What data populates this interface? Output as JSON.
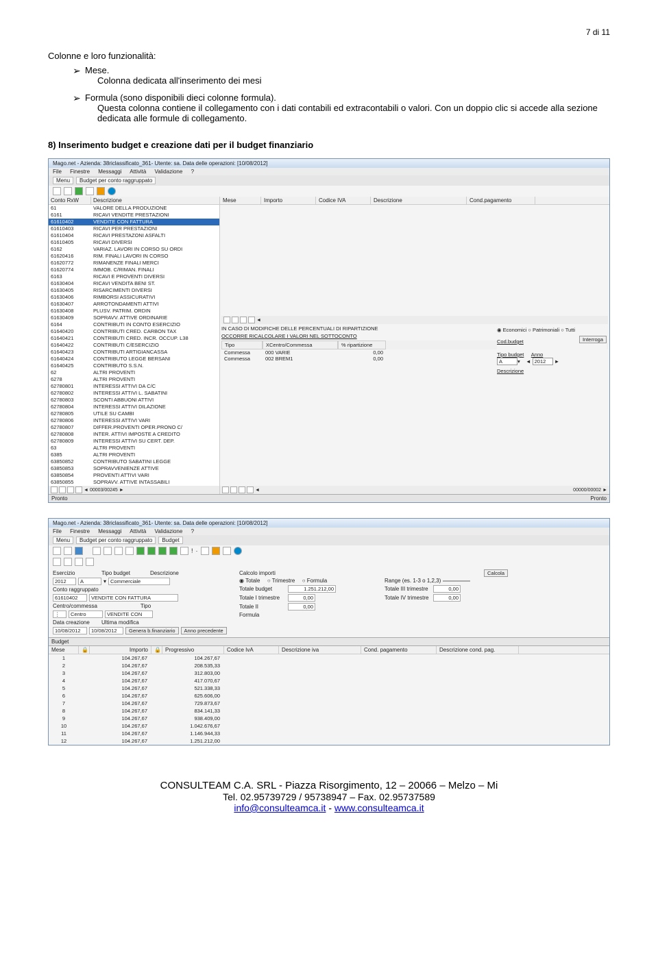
{
  "page_num": "7 di 11",
  "intro_title": "Colonne e loro funzionalità:",
  "bullets": [
    {
      "head": "Mese.",
      "sub": "Colonna dedicata all'inserimento dei mesi"
    },
    {
      "head": "Formula (sono disponibili dieci colonne formula).",
      "sub": "Questa colonna contiene il collegamento con i dati contabili ed extracontabili o valori. Con un doppio clic si accede alla sezione dedicata alle formule di collegamento."
    }
  ],
  "heading8": "8) Inserimento budget e creazione dati per il budget finanziario",
  "ss1": {
    "title": "Mago.net - Azienda: 38riclassificato_361- Utente: sa. Data delle operazioni: [10/08/2012]",
    "menu": [
      "File",
      "Finestre",
      "Messaggi",
      "Attività",
      "Validazione",
      "?"
    ],
    "tab_menu": "Menu",
    "tab_label": "Budget per conto raggruppato",
    "list_header": {
      "code": "Conto RxW",
      "desc": "Descrizione"
    },
    "top_grid": {
      "mese": "Mese",
      "importo": "Importo",
      "iva": "Codice IVA",
      "desc": "Descrizione",
      "cond": "Cond.pagamento"
    },
    "mid_note1": "IN CASO DI MODIFICHE DELLE PERCENTUALI DI RIPARTIZIONE",
    "mid_note2": "OCCORRE RICALCOLARE I VALORI NEL SOTTOCONTO",
    "mid_header": {
      "tipo": "Tipo",
      "centro": "XCentro/Commessa",
      "rip": "% ripartizione"
    },
    "mid_rows": [
      {
        "t": "Commessa",
        "c": "000 VARIE",
        "r": "0,00"
      },
      {
        "t": "Commessa",
        "c": "002 BREM1",
        "r": "0,00"
      }
    ],
    "side": {
      "r1": "Economici",
      "r2": "Patrimoniali",
      "r3": "Tutti",
      "cod": "Cod.budget",
      "btn": "Interroga",
      "tipo": "Tipo budget",
      "tipo_v": "A",
      "anno": "Anno",
      "anno_v": "2012",
      "desc": "Descrizione"
    },
    "nav_count": "00003/00245",
    "nav_count2": "00000/00002",
    "status": "Pronto",
    "accounts": [
      {
        "c": "61",
        "d": "VALORE DELLA PRODUZIONE"
      },
      {
        "c": "6161",
        "d": "RICAVI VENDITE PRESTAZIONI"
      },
      {
        "c": "61610402",
        "d": "VENDITE CON FATTURA",
        "sel": true
      },
      {
        "c": "61610403",
        "d": "RICAVI PER PRESTAZIONI"
      },
      {
        "c": "61610404",
        "d": "RICAVI PRESTAZONI ASFALTI"
      },
      {
        "c": "61610405",
        "d": "RICAVI DIVERSI"
      },
      {
        "c": "6162",
        "d": "VARIAZ. LAVORI IN CORSO SU ORDI"
      },
      {
        "c": "61620416",
        "d": "RIM. FINALI LAVORI IN CORSO"
      },
      {
        "c": "61620772",
        "d": "RIMANENZE FINALI MERCI"
      },
      {
        "c": "61620774",
        "d": "IMMOB. C/RIMAN. FINALI"
      },
      {
        "c": "6163",
        "d": "RICAVI E PROVENTI DIVERSI"
      },
      {
        "c": "61630404",
        "d": "RICAVI VENDITA BENI ST."
      },
      {
        "c": "61630405",
        "d": "RISARCIMENTI DIVERSI"
      },
      {
        "c": "61630406",
        "d": "RIMBORSI ASSICURATIVI"
      },
      {
        "c": "61630407",
        "d": "ARROTONDAMENTI ATTIVI"
      },
      {
        "c": "61630408",
        "d": "PLUSV. PATRIM. ORDIN"
      },
      {
        "c": "61630409",
        "d": "SOPRAVV. ATTIVE ORDINARIE"
      },
      {
        "c": "6164",
        "d": "CONTRIBUTI IN CONTO ESERCIZIO"
      },
      {
        "c": "61640420",
        "d": "CONTRIBUTI CRED. CARBON TAX"
      },
      {
        "c": "61640421",
        "d": "CONTRIBUTI CRED. INCR. OCCUP. L38"
      },
      {
        "c": "61640422",
        "d": "CONTRIBUTI C/ESERCIZIO"
      },
      {
        "c": "61640423",
        "d": "CONTRIBUTI ARTIGIANCASSA"
      },
      {
        "c": "61640424",
        "d": "CONTRIBUTO LEGGE BERSANI"
      },
      {
        "c": "61640425",
        "d": "CONTRIBUTO S.S.N."
      },
      {
        "c": "62",
        "d": "ALTRI PROVENTI"
      },
      {
        "c": "6278",
        "d": "ALTRI PROVENTI"
      },
      {
        "c": "62780801",
        "d": "INTERESSI ATTIVI DA C/C"
      },
      {
        "c": "62780802",
        "d": "INTERESSI ATTIVI L. SABATINI"
      },
      {
        "c": "62780803",
        "d": "SCONTI ABBUONI ATTIVI"
      },
      {
        "c": "62780804",
        "d": "INTERESSI ATTIVI DILAZIONE"
      },
      {
        "c": "62780805",
        "d": "UTILE SU CAMBI"
      },
      {
        "c": "62780806",
        "d": "INTERESSI ATTIVI VARI"
      },
      {
        "c": "62780807",
        "d": "DIFFER.PROVENTI OPER.PRONO C/"
      },
      {
        "c": "62780808",
        "d": "INTER. ATTIVI IMPOSTE A CREDITO"
      },
      {
        "c": "62780809",
        "d": "INTERESSI ATTIVI SU CERT. DEP."
      },
      {
        "c": "63",
        "d": "ALTRI PROVENTI"
      },
      {
        "c": "6385",
        "d": "ALTRI PROVENTI"
      },
      {
        "c": "63850852",
        "d": "CONTRIBUTO SABATINI LEGGE"
      },
      {
        "c": "63850853",
        "d": "SOPRAVVENIENZE ATTIVE"
      },
      {
        "c": "63850854",
        "d": "PROVENTI ATTIVI VARI"
      },
      {
        "c": "63850855",
        "d": "SOPRAVV. ATTIVE INTASSABILI"
      }
    ]
  },
  "ss2": {
    "title": "Mago.net - Azienda: 38riclassificato_361- Utente: sa. Data delle operazioni: [10/08/2012]",
    "menu": [
      "File",
      "Finestre",
      "Messaggi",
      "Attività",
      "Validazione",
      "?"
    ],
    "tabs": [
      "Menu",
      "Budget per conto raggruppato",
      "Budget"
    ],
    "form": {
      "esercizio_l": "Esercizio",
      "esercizio_v": "2012",
      "tipo_l": "Tipo budget",
      "tipo_v": "A",
      "desc_l": "Descrizione",
      "desc_v": "Commerciale",
      "conto_l": "Conto raggruppato",
      "conto_c": "61610402",
      "conto_d": "VENDITE CON FATTURA",
      "centro_l": "Centro/commessa",
      "centro_v": "Centro",
      "centro_tipo_l": "Tipo",
      "centro_tipo_v": "VENDITE CON",
      "datac_l": "Data creazione",
      "datac_v": "10/08/2012",
      "datam_l": "Ultima modifica",
      "datam_v": "10/08/2012",
      "btn_gen": "Genera b.finanziario",
      "btn_anno": "Anno precedente",
      "calc_head": "Calcolo importi",
      "r_totale": "Totale",
      "r_trim": "Trimestre",
      "r_form": "Formula",
      "btn_calc": "Calcola",
      "tot_l": "Totale budget",
      "tot_v": "1.251.212,00",
      "range_l": "Range (es. 1-3 o 1,2,3)",
      "t1_l": "Totale I trimestre",
      "t1_v": "0,00",
      "t2_l": "Totale II",
      "t2_v": "0,00",
      "t3_l": "Totale III trimestre",
      "t3_v": "0,00",
      "t4_l": "Totale IV trimestre",
      "t4_v": "0,00",
      "form_l": "Formula"
    },
    "budget_tab": "Budget",
    "bud_head": {
      "mese": "Mese",
      "imp": "Importo",
      "prog": "Progressivo",
      "iva": "Codice IvA",
      "desc": "Descrizione iva",
      "cond": "Cond. pagamento",
      "dcp": "Descrizione cond. pag."
    },
    "bud_rows": [
      {
        "m": "1",
        "i": "104.267,67",
        "p": "104.267,67"
      },
      {
        "m": "2",
        "i": "104.267,67",
        "p": "208.535,33"
      },
      {
        "m": "3",
        "i": "104.267,67",
        "p": "312.803,00"
      },
      {
        "m": "4",
        "i": "104.267,67",
        "p": "417.070,67"
      },
      {
        "m": "5",
        "i": "104.267,67",
        "p": "521.338,33"
      },
      {
        "m": "6",
        "i": "104.267,67",
        "p": "625.606,00"
      },
      {
        "m": "7",
        "i": "104.267,67",
        "p": "729.873,67"
      },
      {
        "m": "8",
        "i": "104.267,67",
        "p": "834.141,33"
      },
      {
        "m": "9",
        "i": "104.267,67",
        "p": "938.409,00"
      },
      {
        "m": "10",
        "i": "104.267,67",
        "p": "1.042.676,67"
      },
      {
        "m": "11",
        "i": "104.267,67",
        "p": "1.146.944,33"
      },
      {
        "m": "12",
        "i": "104.267,67",
        "p": "1.251.212,00"
      }
    ]
  },
  "footer": {
    "line1": "CONSULTEAM C.A. SRL - Piazza Risorgimento, 12 – 20066 – Melzo – Mi",
    "line2": "Tel. 02.95739729 / 95738947 – Fax. 02.95737589",
    "email": "info@consulteamca.it",
    "sep": "  -  ",
    "web": "www.consulteamca.it"
  }
}
